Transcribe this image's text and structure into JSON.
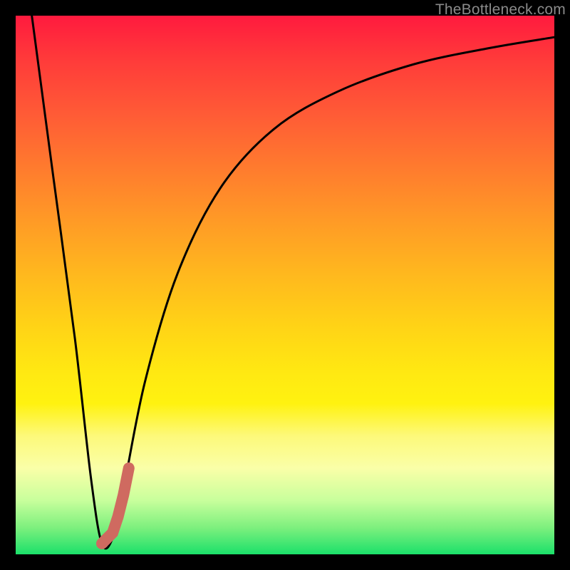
{
  "watermark": "TheBottleneck.com",
  "chart_data": {
    "type": "line",
    "title": "",
    "xlabel": "",
    "ylabel": "",
    "xlim": [
      0,
      100
    ],
    "ylim": [
      0,
      100
    ],
    "series": [
      {
        "name": "curve",
        "x": [
          3,
          7,
          11,
          14,
          16,
          18,
          20,
          24,
          30,
          38,
          48,
          60,
          74,
          88,
          100
        ],
        "values": [
          100,
          70,
          40,
          14,
          2,
          3,
          12,
          32,
          52,
          68,
          79,
          86,
          91,
          94,
          96
        ]
      },
      {
        "name": "highlight",
        "x": [
          16,
          17,
          18,
          19,
          20,
          21
        ],
        "values": [
          2,
          3,
          4,
          7,
          11,
          16
        ]
      }
    ],
    "gradient_stops": [
      {
        "pos": 0,
        "color": "#ff1a3e"
      },
      {
        "pos": 50,
        "color": "#ffd416"
      },
      {
        "pos": 85,
        "color": "#faffa8"
      },
      {
        "pos": 100,
        "color": "#1be06a"
      }
    ]
  }
}
